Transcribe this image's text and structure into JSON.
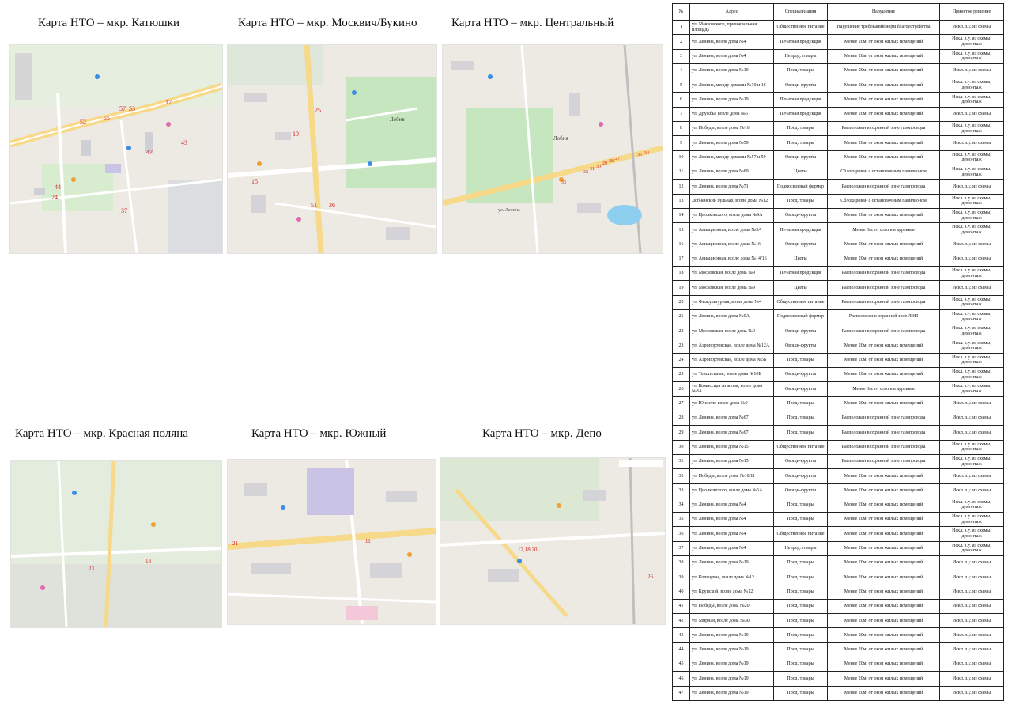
{
  "maps": [
    {
      "title": "Карта НТО   – мкр. Катюшки",
      "markers": [
        "57",
        "53",
        "55",
        "52",
        "17",
        "43",
        "47",
        "44",
        "37",
        "24"
      ]
    },
    {
      "title": "Карта НТО   – мкр.  Москвич/Букино",
      "markers": [
        "19",
        "25",
        "15",
        "51",
        "36"
      ]
    },
    {
      "title": "Карта НТО   – мкр. Центральный",
      "markers": [
        "27",
        "28",
        "29",
        "30",
        "31",
        "32",
        "33",
        "34",
        "35"
      ]
    },
    {
      "title": "Карта НТО   – мкр. Красная поляна",
      "markers": [
        "23",
        "13"
      ]
    },
    {
      "title": "Карта НТО   – мкр. Южный",
      "markers": [
        "11",
        "21"
      ]
    },
    {
      "title": "Карта НТО   – мкр. Депо",
      "markers": [
        "12,18,20",
        "26"
      ]
    }
  ],
  "map_labels": {
    "lobnya": "Лобня",
    "lenina_street": "ул. Ленина"
  },
  "table": {
    "headers": [
      "№",
      "Адрес",
      "Специализация",
      "Нарушение",
      "Принятое решение"
    ],
    "rows": [
      [
        "1",
        "ул. Маяковского, привокзальная площадь",
        "Общественное питание",
        "Нарушение требований норм благоустройства",
        "Искл. з.у. из схемы"
      ],
      [
        "2",
        "ул. Ленина,  возле дома №4",
        "Печатная продукция",
        "Менее 20м. от окон жилых помещений",
        "Искл. з.у. из схемы, демонтаж"
      ],
      [
        "3",
        "ул. Ленина, возле дома №4",
        "Непрод. товары",
        "Менее 20м. от окон жилых помещений",
        "Искл. з.у. из схемы, демонтаж"
      ],
      [
        "4",
        "ул. Ленина, возле дома №10",
        "Прод. товары",
        "Менее 20м. от окон жилых помещений",
        "Искл. з.у. из схемы"
      ],
      [
        "5",
        "ул. Ленина, между домами №10 и 16",
        "Овощи-фрукты",
        "Менее 20м. от окон жилых помещений",
        "Искл. з.у. из схемы, демонтаж"
      ],
      [
        "6",
        "ул. Ленина, возле дома №19",
        "Печатная продукция",
        "Менее 20м. от окон жилых помещений",
        "Искл. з.у. из схемы, демонтаж"
      ],
      [
        "7",
        "ул. Дружбы, возле дома №6",
        "Печатная продукция",
        "Менее 20м. от окон жилых помещений",
        "Искл. з.у. из схемы"
      ],
      [
        "8",
        "ул. Победы, возле дома №16",
        "Прод. товары",
        "Расположен в охранной зоне газопровода",
        "Искл. з.у. из схемы, демонтаж"
      ],
      [
        "9",
        "ул. Ленина, возле дома №59",
        "Прод. товары",
        "Менее 20м. от окон жилых помещений",
        "Искл. з.у. из схемы"
      ],
      [
        "10",
        "ул. Ленина, между домами №57 и 59",
        "Овощи-фрукты",
        "Менее 20м. от окон жилых помещений",
        "Искл. з.у. из схемы, демонтаж"
      ],
      [
        "11",
        "ул. Ленина, возле дома №69",
        "Цветы",
        "Сблокирован с остановочным павильоном",
        "Искл. з.у. из схемы, демонтаж"
      ],
      [
        "12",
        "ул. Ленина, возле дома №71",
        "Подмосковный фермер",
        "Расположен в охранной зоне газопровода",
        "Искл. з.у. из схемы"
      ],
      [
        "13",
        "Лобненский бульвар, возле дома №12",
        "Прод. товары",
        "Сблокирован с остановочным павильоном",
        "Искл. з.у. из схемы, демонтаж"
      ],
      [
        "14",
        "ул. Циолковского, возле дома №9А",
        "Овощи-фрукты",
        "Менее 20м. от окон жилых помещений",
        "Искл. з.у. из схемы, демонтаж"
      ],
      [
        "15",
        "ул. Авиационная, возле дома №3А",
        "Печатная продукция",
        "Менее 3м. от стволов деревьев",
        "Искл. з.у. из схемы, демонтаж"
      ],
      [
        "16",
        "ул. Авиационная, возле дома №16",
        "Овощи-фрукты",
        "Менее 20м. от окон жилых помещений",
        "Искл. з.у. из схемы"
      ],
      [
        "17",
        "ул. Авиационная, возле дома №14/16",
        "Цветы",
        "Менее 20м. от окон жилых помещений",
        "Искл. з.у. из схемы"
      ],
      [
        "18",
        "ул. Московская, возле дома №9",
        "Печатная продукция",
        "Расположен в охранной зоне газопровода",
        "Искл. з.у. из схемы, демонтаж"
      ],
      [
        "19",
        "ул. Московская, возле дома №9",
        "Цветы",
        "Расположен в охранной зоне газопровода",
        "Искл. з.у. из схемы"
      ],
      [
        "20",
        "ул. Физкультурная, возле дома №4",
        "Общественное питание",
        "Расположен в охранной зоне газопровода",
        "Искл. з.у. из схемы, демонтаж"
      ],
      [
        "21",
        "ул. Ленина, возле дома №9А",
        "Подмосковный фермер",
        "Расположен в охранной зоне ЛЭП",
        "Искл. з.у. из схемы, демонтаж"
      ],
      [
        "22",
        "ул. Московская, возле дома №9",
        "Овощи-фрукты",
        "Расположен в охранной зоне газопровода",
        "Искл. з.у. из схемы, демонтаж"
      ],
      [
        "23",
        "ул. Аэропортовская, возле дома №12А",
        "Овощи-фрукты",
        "Менее 20м. от окон жилых помещений",
        "Искл. з.у. из схемы, демонтаж"
      ],
      [
        "24",
        "ул. Аэропортовская, возле дома №5Б",
        "Прод. товары",
        "Менее 20м. от окон жилых помещений",
        "Искл. з.у. из схемы, демонтаж"
      ],
      [
        "25",
        "ул. Текстильная, возле дома №10Б",
        "Овощи-фрукты",
        "Менее 20м. от окон жилых помещений",
        "Искл. з.у. из схемы, демонтаж"
      ],
      [
        "26",
        "ул. Комиссара Агапова, возле дома №8А",
        "Овощи-фрукты",
        "Менее 3м. от стволов деревьев",
        "Искл. з.у. из схемы, демонтаж"
      ],
      [
        "27",
        "ул. Юности, возле дома №9",
        "Прод. товары",
        "Менее 20м. от окон жилых помещений",
        "Искл. з.у. из схемы"
      ],
      [
        "28",
        "ул. Ленина, возле дома №67",
        "Прод. товары",
        "Расположен в охранной зоне газопровода",
        "Искл. з.у. из схемы"
      ],
      [
        "29",
        "ул. Ленина, возле дома №67",
        "Прод. товары",
        "Расположен в охранной зоне газопровода",
        "Искл. з.у. из схемы"
      ],
      [
        "30",
        "ул. Ленина, возле дома №15",
        "Общественное питание",
        "Расположен в охранной зоне газопровода",
        "Искл. з.у. из схемы, демонтаж"
      ],
      [
        "31",
        "ул. Ленина, возле дома №15",
        "Овощи-фрукты",
        "Расположен в охранной зоне газопровода",
        "Искл. з.у. из схемы, демонтаж"
      ],
      [
        "32",
        "ул. Победы, возле дома №10/11",
        "Овощи-фрукты",
        "Менее 20м. от окон жилых помещений",
        "Искл. з.у. из схемы"
      ],
      [
        "33",
        "ул. Циолковского, возле дома №6А",
        "Овощи-фрукты",
        "Менее 20м. от окон жилых помещений",
        "Искл. з.у. из схемы"
      ],
      [
        "34",
        "ул. Ленина, возле дома №4",
        "Прод. товары",
        "Менее 20м. от окон жилых помещений",
        "Искл. з.у. из схемы, демонтаж"
      ],
      [
        "35",
        "ул. Ленина, возле дома №4",
        "Прод. товары",
        "Менее 20м. от окон жилых помещений",
        "Искл. з.у. из схемы, демонтаж"
      ],
      [
        "36",
        "ул. Ленина, возле дома №4",
        "Общественное питание",
        "Менее 20м. от окон жилых помещений",
        "Искл. з.у. из схемы, демонтаж"
      ],
      [
        "37",
        "ул. Ленина, возле дома №4",
        "Непрод. товары",
        "Менее 20м. от окон жилых помещений",
        "Искл. з.у. из схемы, демонтаж"
      ],
      [
        "38",
        "ул. Ленина, возле дома №19",
        "Прод. товары",
        "Менее 20м. от окон жилых помещений",
        "Искл. з.у. из схемы"
      ],
      [
        "39",
        "ул. Кольцевая, возле дома №12",
        "Прод. товары",
        "Менее 20м. от окон жилых помещений",
        "Искл. з.у. из схемы"
      ],
      [
        "40",
        "ул. Крупской, возле дома №12",
        "Прод. товары",
        "Менее 20м. от окон жилых помещений",
        "Искл. з.у. из схемы"
      ],
      [
        "41",
        "ул. Победы, возле дома №20",
        "Прод. товары",
        "Менее 20м. от окон жилых помещений",
        "Искл. з.у. из схемы"
      ],
      [
        "42",
        "ул. Мирная, возле дома №30",
        "Прод. товары",
        "Менее 20м. от окон жилых помещений",
        "Искл. з.у. из схемы"
      ],
      [
        "43",
        "ул. Ленина, возле дома №19",
        "Прод. товары",
        "Менее 20м. от окон жилых помещений",
        "Искл. з.у. из схемы"
      ],
      [
        "44",
        "ул. Ленина, возле дома №19",
        "Прод. товары",
        "Менее 20м. от окон жилых помещений",
        "Искл. з.у. из схемы"
      ],
      [
        "45",
        "ул. Ленина, возле дома №19",
        "Прод. товары",
        "Менее 20м. от окон жилых помещений",
        "Искл. з.у. из схемы"
      ],
      [
        "46",
        "ул. Ленина, возле дома №19",
        "Прод. товары",
        "Менее 20м. от окон жилых помещений",
        "Искл. з.у. из схемы"
      ],
      [
        "47",
        "ул. Ленина, возле дома №19",
        "Прод. товары",
        "Менее 20м. от окон жилых помещений",
        "Искл. з.у. из схемы"
      ]
    ]
  }
}
